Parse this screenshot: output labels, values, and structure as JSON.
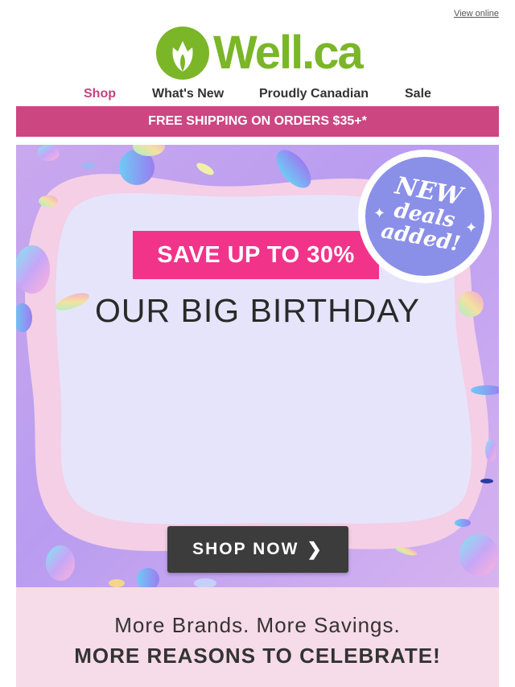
{
  "header": {
    "view_online": "View online",
    "logo_text": "Well.ca"
  },
  "nav": {
    "items": [
      {
        "label": "Shop",
        "active": true
      },
      {
        "label": "What's New"
      },
      {
        "label": "Proudly Canadian"
      },
      {
        "label": "Sale"
      }
    ]
  },
  "shipping_bar": "FREE SHIPPING ON ORDERS $35+*",
  "hero": {
    "save_tag": "SAVE UP TO 30%",
    "title": "OUR BIG BIRTHDAY",
    "badge": {
      "line1": "NEW",
      "line2": "deals",
      "line3": "added!"
    },
    "cta_label": "SHOP NOW",
    "cta_icon": "chevron-right-icon"
  },
  "promo": {
    "line1": "More Brands. More Savings.",
    "line2": "MORE REASONS TO CELEBRATE!"
  },
  "colors": {
    "brand_green": "#7ab628",
    "brand_pink": "#cc4682",
    "save_pink": "#f2338a",
    "badge_purple": "#8a8fe8"
  }
}
